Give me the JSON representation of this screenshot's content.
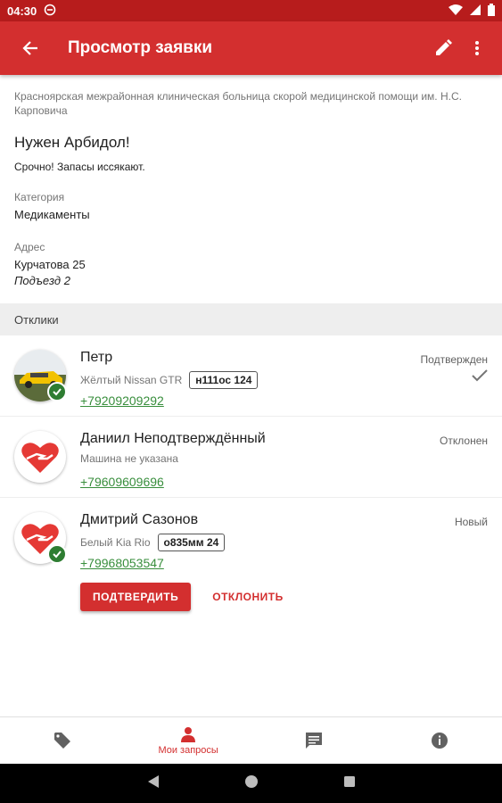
{
  "statusbar": {
    "time": "04:30"
  },
  "appbar": {
    "title": "Просмотр заявки"
  },
  "request": {
    "organization": "Красноярская межрайонная клиническая больница скорой медицинской помощи им. Н.С. Карповича",
    "title": "Нужен Арбидол!",
    "description": "Срочно! Запасы иссякают.",
    "category_label": "Категория",
    "category_value": "Медикаменты",
    "address_label": "Адрес",
    "address_line1": "Курчатова 25",
    "address_line2": "Подъезд 2"
  },
  "responses_header": "Отклики",
  "responses": [
    {
      "name": "Петр",
      "car": "Жёлтый Nissan GTR",
      "plate": "н111ос 124",
      "phone": "+79209209292",
      "status": "Подтвержден"
    },
    {
      "name": "Даниил Неподтверждённый",
      "car": "Машина не указана",
      "plate": "",
      "phone": "+79609609696",
      "status": "Отклонен"
    },
    {
      "name": "Дмитрий Сазонов",
      "car": "Белый Kia Rio",
      "plate": "о835мм 24",
      "phone": "+79968053547",
      "status": "Новый"
    }
  ],
  "actions": {
    "confirm": "ПОДТВЕРДИТЬ",
    "reject": "ОТКЛОНИТЬ"
  },
  "bottom_nav": {
    "items": [
      {
        "icon": "tag-icon",
        "label": ""
      },
      {
        "icon": "person-icon",
        "label": "Мои запросы"
      },
      {
        "icon": "chat-icon",
        "label": ""
      },
      {
        "icon": "info-icon",
        "label": ""
      }
    ]
  },
  "colors": {
    "primary": "#d32f2f",
    "primary_dark": "#b71c1c",
    "phone_green": "#388e3c",
    "badge_green": "#2e7d32"
  }
}
